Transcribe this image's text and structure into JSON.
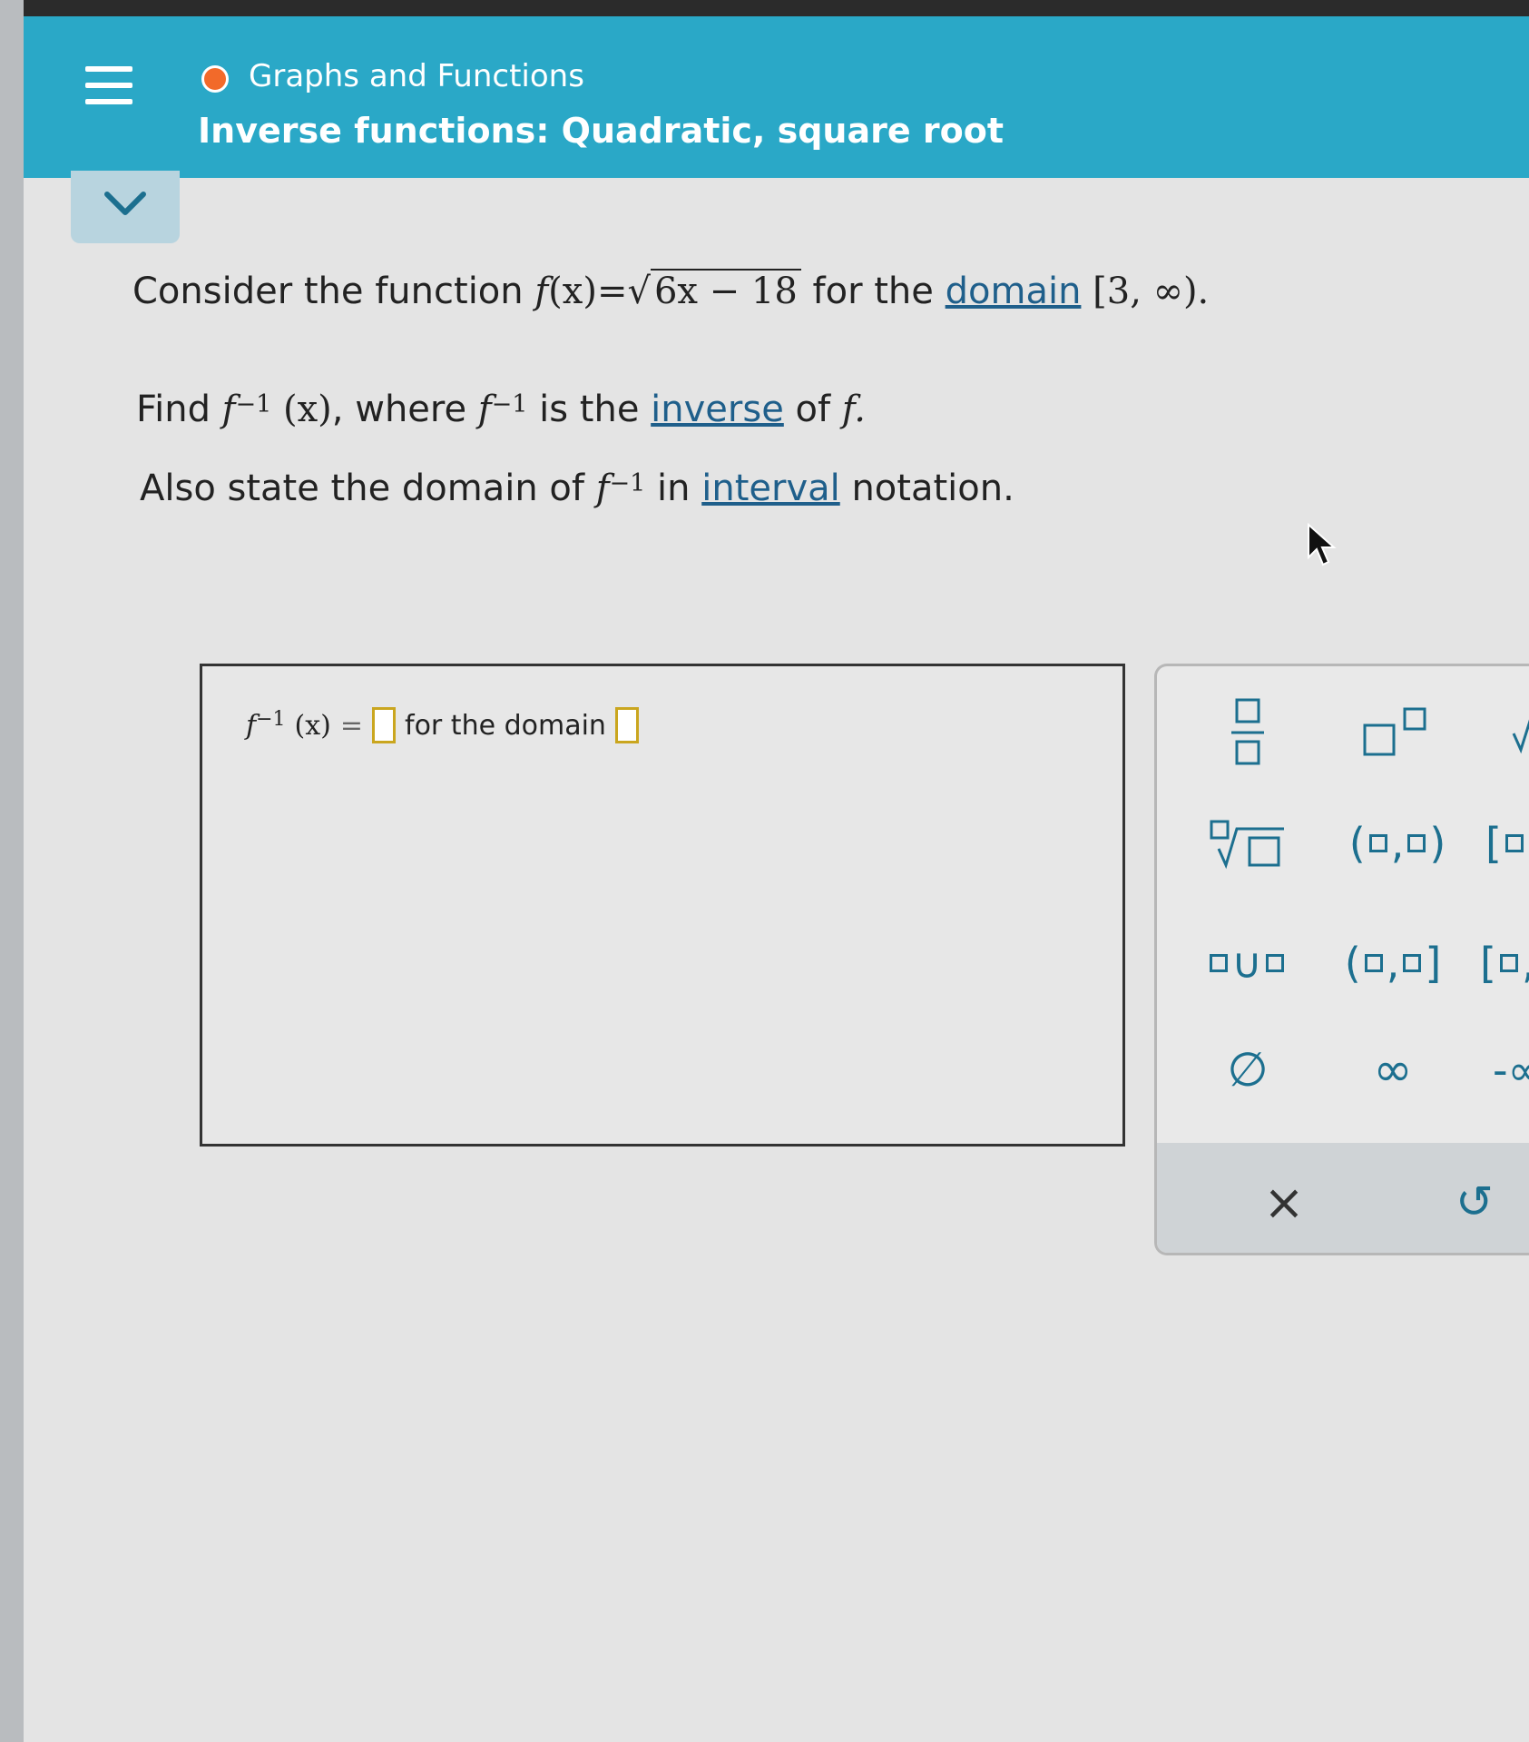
{
  "header": {
    "breadcrumb": "Graphs and Functions",
    "title": "Inverse functions: Quadratic, square root"
  },
  "question": {
    "line1_prefix": "Consider the function",
    "line1_fx": "f",
    "line1_x": "(x)",
    "line1_eq": "=",
    "line1_radicand": "6x − 18",
    "line1_mid": "for the",
    "line1_link": "domain",
    "line1_interval": "[3, ∞).",
    "line2_find": "Find",
    "line2_f": "f",
    "line2_exp": "−1",
    "line2_x": "(x)",
    "line2_where": ", where",
    "line2_f2": "f",
    "line2_exp2": "−1",
    "line2_isthe": "is the",
    "line2_link": "inverse",
    "line2_of": "of",
    "line2_f3": "f.",
    "line3_prefix": "Also state the domain of",
    "line3_f": "f",
    "line3_exp": "−1",
    "line3_in": "in",
    "line3_link": "interval",
    "line3_suffix": "notation."
  },
  "answer": {
    "f": "f",
    "exp": "−1",
    "x": "(x)",
    "eq": "=",
    "mid": "for the domain"
  },
  "keypad": {
    "union": "∪",
    "open_interval_left": "(",
    "open_interval_right": ")",
    "halfopen_left": "(",
    "halfopen_right": "]",
    "closed_left": "[",
    "comma": ",",
    "empty_set": "∅",
    "infinity": "∞",
    "neg_infinity": "-∞",
    "clear": "×",
    "undo": "↺"
  },
  "colors": {
    "header": "#2aa8c7",
    "accent": "#1c6f8f",
    "status_dot": "#f26a2a",
    "answer_slot_border": "#caa61f"
  }
}
